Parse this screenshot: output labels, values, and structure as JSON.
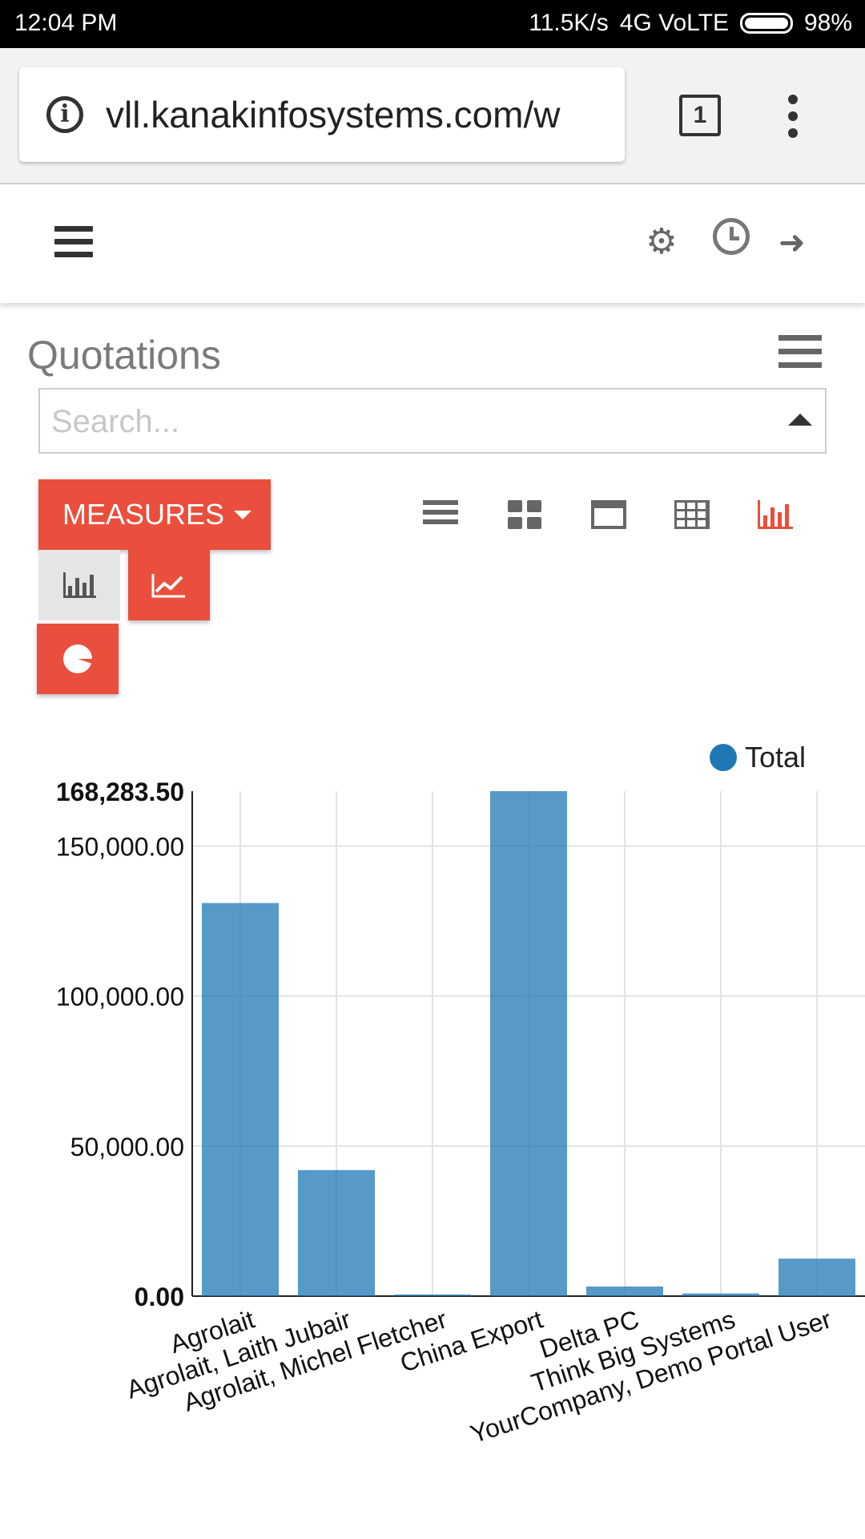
{
  "status_bar": {
    "time": "12:04 PM",
    "speed": "11.5K/s",
    "network": "4G VoLTE",
    "battery": "98%"
  },
  "browser": {
    "url": "vll.kanakinfosystems.com/w",
    "tab_count": "1"
  },
  "page": {
    "title": "Quotations",
    "search_placeholder": "Search...",
    "measures_label": "MEASURES"
  },
  "views": [
    "list-view-icon",
    "kanban-view-icon",
    "calendar-view-icon",
    "pivot-view-icon",
    "graph-view-icon"
  ],
  "colors": {
    "accent": "#e94f3c",
    "bar": "#1f77b4"
  },
  "legend": {
    "label": "Total"
  },
  "chart_data": {
    "type": "bar",
    "categories": [
      "Agrolait",
      "Agrolait, Laith Jubair",
      "Agrolait, Michel Fletcher",
      "China Export",
      "Delta PC",
      "Think Big Systems",
      "YourCompany, Demo Portal User"
    ],
    "series": [
      {
        "name": "Total",
        "values": [
          131000,
          42000,
          300,
          168283.5,
          3200,
          900,
          12500
        ]
      }
    ],
    "yticks": [
      "0.00",
      "50,000.00",
      "100,000.00",
      "150,000.00",
      "168,283.50"
    ],
    "ylim": [
      0,
      168283.5
    ],
    "grid": true,
    "legend_position": "top-right"
  }
}
